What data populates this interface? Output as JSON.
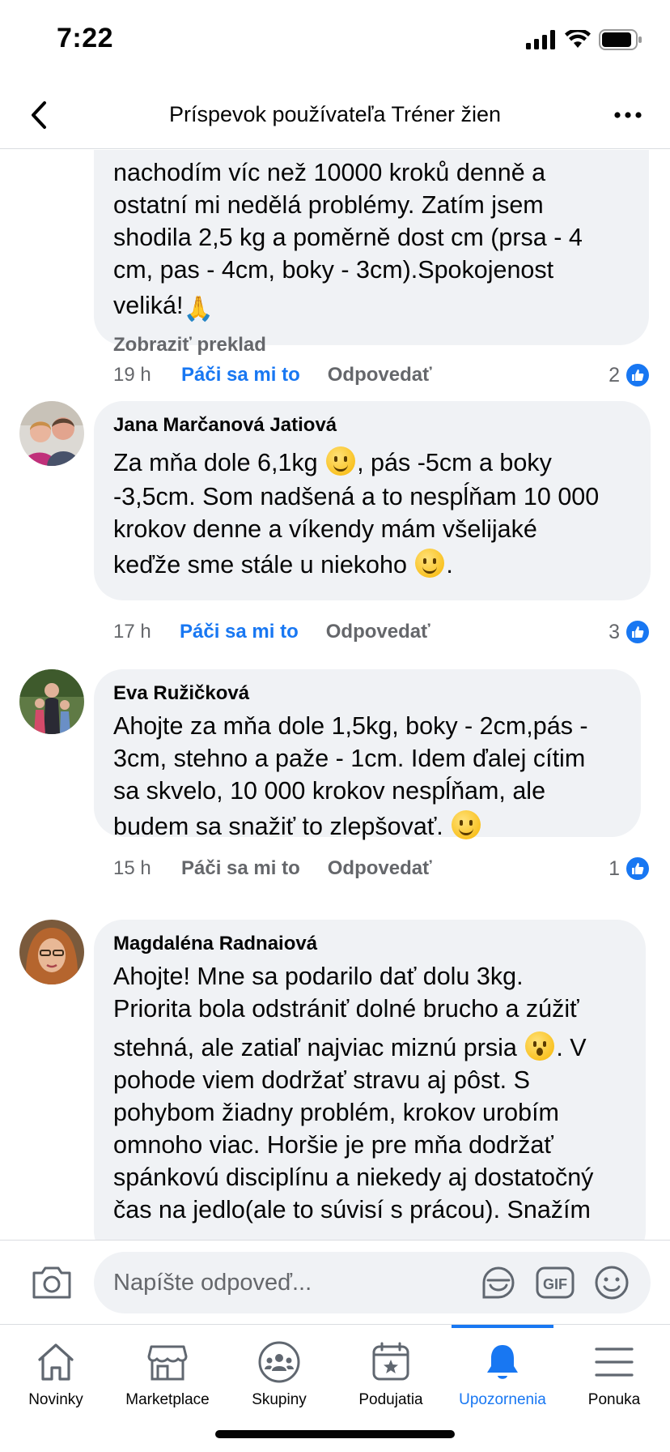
{
  "status": {
    "time": "7:22"
  },
  "header": {
    "title": "Príspevok používateľa Tréner žien"
  },
  "comments": [
    {
      "lines": [
        "nachodím víc než 10000 kroků denně a",
        "ostatní mi nedělá problémy. Zatím jsem",
        "shodila 2,5 kg a poměrně dost cm (prsa - 4",
        "cm, pas - 4cm, boky  - 3cm).Spokojenost",
        "veliká!"
      ],
      "translate": "Zobraziť preklad",
      "time": "19 h",
      "like": "Páči sa mi to",
      "reply": "Odpovedať",
      "likes": "2"
    },
    {
      "author": "Jana Marčanová Jatiová",
      "lines": [
        "Za mňa dole 6,1kg",
        ", pás -5cm a boky",
        "-3,5cm. Som nadšená a to nespĺňam 10 000",
        "krokov denne a víkendy mám všelijaké",
        "keďže sme stále u niekoho",
        "."
      ],
      "time": "17 h",
      "like": "Páči sa mi to",
      "reply": "Odpovedať",
      "likes": "3"
    },
    {
      "author": "Eva Ružičková",
      "lines": [
        "Ahojte za mňa dole 1,5kg, boky - 2cm,pás -",
        "3cm, stehno a paže - 1cm. Idem ďalej cítim",
        "sa skvelo, 10 000 krokov nespĺňam, ale",
        "budem sa snažiť to zlepšovať."
      ],
      "time": "15 h",
      "like": "Páči sa mi to",
      "reply": "Odpovedať",
      "likes": "1"
    },
    {
      "author": "Magdaléna Radnaiová",
      "lines": [
        "Ahojte!  Mne sa podarilo dať dolu 3kg.",
        "Priorita bola odstrániť dolné brucho a zúžiť",
        "stehná, ale zatiaľ najviac miznú prsia",
        ". V",
        "pohode viem dodržať stravu aj pôst. S",
        "pohybom žiadny problém, krokov urobím",
        "omnoho viac. Horšie  je pre mňa dodržať",
        "spánkovú disciplínu a niekedy aj dostatočný",
        "čas na jedlo(ale to súvisí s prácou). Snažím"
      ]
    }
  ],
  "composer": {
    "placeholder": "Napíšte odpoveď..."
  },
  "nav": [
    {
      "label": "Novinky",
      "icon": "home-icon"
    },
    {
      "label": "Marketplace",
      "icon": "marketplace-icon"
    },
    {
      "label": "Skupiny",
      "icon": "groups-icon"
    },
    {
      "label": "Podujatia",
      "icon": "events-icon"
    },
    {
      "label": "Upozornenia",
      "icon": "bell-icon",
      "active": true
    },
    {
      "label": "Ponuka",
      "icon": "menu-icon"
    }
  ],
  "colors": {
    "accent": "#1877f2",
    "bubble": "#f0f2f5",
    "secondary_text": "#65676b"
  }
}
